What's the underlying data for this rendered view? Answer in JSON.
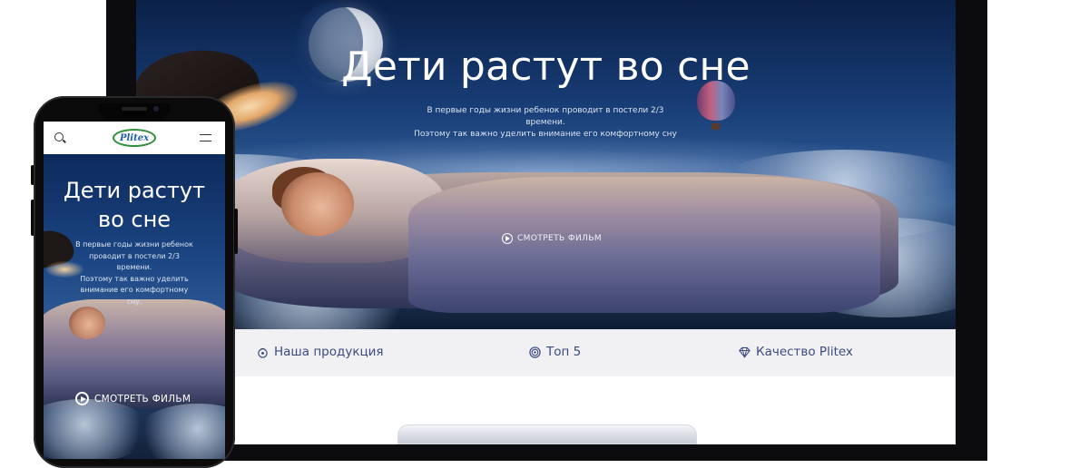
{
  "desktop": {
    "hero": {
      "title": "Дети растут во сне",
      "subtitle_lines": [
        "В первые годы жизни ребенок проводит в постели 2/3 времени.",
        "Поэтому так важно уделить внимание его комфортному сну"
      ],
      "watch_label": "СМОТРЕТЬ ФИЛЬМ"
    },
    "nav": [
      {
        "icon": "product-icon",
        "label": "Наша продукция"
      },
      {
        "icon": "target-icon",
        "label": "Топ 5"
      },
      {
        "icon": "diamond-icon",
        "label": "Качество Plitex"
      }
    ]
  },
  "mobile": {
    "logo": "Plitex",
    "hero": {
      "title_lines": [
        "Дети растут",
        "во сне"
      ],
      "subtitle_lines": [
        "В первые годы жизни ребенок",
        "проводит в постели 2/3 времени.",
        "Поэтому так важно уделить",
        "внимание его комфортному сну."
      ],
      "watch_label": "СМОТРЕТЬ ФИЛЬМ"
    }
  },
  "colors": {
    "nav_text": "#3b4a80",
    "logo_green": "#2f8f3a",
    "logo_blue": "#1e5fa8",
    "hero_top": "#0b2148"
  }
}
